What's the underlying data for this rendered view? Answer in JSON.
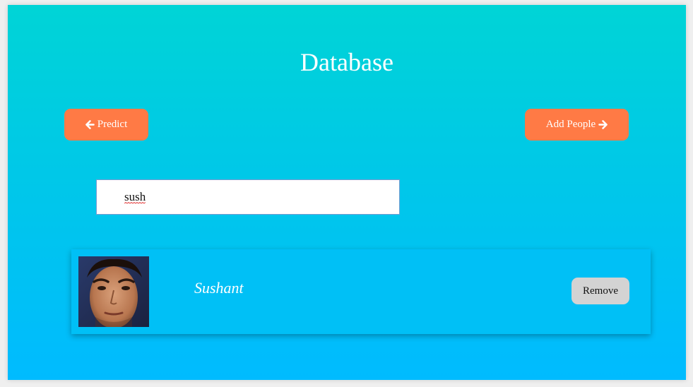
{
  "page": {
    "title": "Database"
  },
  "nav": {
    "predict_label": "Predict",
    "add_people_label": "Add People"
  },
  "search": {
    "value": "sush"
  },
  "results": [
    {
      "name": "Sushant",
      "remove_label": "Remove"
    }
  ],
  "colors": {
    "gradient_top": "#00d4d6",
    "gradient_bottom": "#00bbff",
    "button_orange": "#ff7a45",
    "remove_gray": "#d3d3d3",
    "card_bg": "#00c0f6"
  },
  "icons": {
    "predict_icon": "arrow-left-icon",
    "add_people_icon": "arrow-right-icon"
  }
}
